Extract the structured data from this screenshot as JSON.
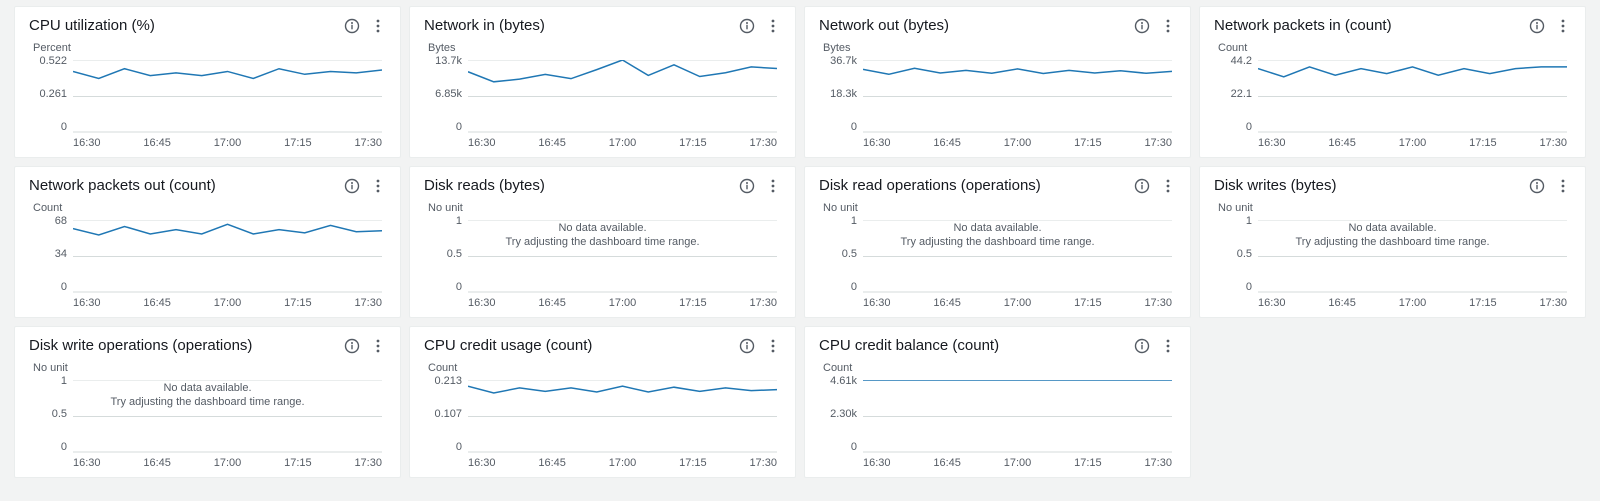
{
  "x_ticks": [
    "16:30",
    "16:45",
    "17:00",
    "17:15",
    "17:30"
  ],
  "nodata": {
    "line1": "No data available.",
    "line2": "Try adjusting the dashboard time range."
  },
  "panels": [
    {
      "id": "cpu-utilization",
      "title": "CPU utilization (%)",
      "unit": "Percent",
      "y_ticks": [
        "0.522",
        "0.261",
        "0"
      ],
      "series_key": "cpu_utilization"
    },
    {
      "id": "network-in",
      "title": "Network in (bytes)",
      "unit": "Bytes",
      "y_ticks": [
        "13.7k",
        "6.85k",
        "0"
      ],
      "series_key": "network_in"
    },
    {
      "id": "network-out",
      "title": "Network out (bytes)",
      "unit": "Bytes",
      "y_ticks": [
        "36.7k",
        "18.3k",
        "0"
      ],
      "series_key": "network_out"
    },
    {
      "id": "network-packets-in",
      "title": "Network packets in (count)",
      "unit": "Count",
      "y_ticks": [
        "44.2",
        "22.1",
        "0"
      ],
      "series_key": "network_packets_in"
    },
    {
      "id": "network-packets-out",
      "title": "Network packets out (count)",
      "unit": "Count",
      "y_ticks": [
        "68",
        "34",
        "0"
      ],
      "series_key": "network_packets_out"
    },
    {
      "id": "disk-reads",
      "title": "Disk reads (bytes)",
      "unit": "No unit",
      "y_ticks": [
        "1",
        "0.5",
        "0"
      ],
      "nodata": true
    },
    {
      "id": "disk-read-operations",
      "title": "Disk read operations (operations)",
      "unit": "No unit",
      "y_ticks": [
        "1",
        "0.5",
        "0"
      ],
      "nodata": true
    },
    {
      "id": "disk-writes",
      "title": "Disk writes (bytes)",
      "unit": "No unit",
      "y_ticks": [
        "1",
        "0.5",
        "0"
      ],
      "nodata": true
    },
    {
      "id": "disk-write-operations",
      "title": "Disk write operations (operations)",
      "unit": "No unit",
      "y_ticks": [
        "1",
        "0.5",
        "0"
      ],
      "nodata": true
    },
    {
      "id": "cpu-credit-usage",
      "title": "CPU credit usage (count)",
      "unit": "Count",
      "y_ticks": [
        "0.213",
        "0.107",
        "0"
      ],
      "series_key": "cpu_credit_usage"
    },
    {
      "id": "cpu-credit-balance",
      "title": "CPU credit balance (count)",
      "unit": "Count",
      "y_ticks": [
        "4.61k",
        "2.30k",
        "0"
      ],
      "series_key": "cpu_credit_balance"
    }
  ],
  "chart_data": {
    "type": "line",
    "x": [
      "16:30",
      "16:35",
      "16:40",
      "16:45",
      "16:50",
      "16:55",
      "17:00",
      "17:05",
      "17:10",
      "17:15",
      "17:20",
      "17:25",
      "17:30"
    ],
    "xlim": [
      "16:30",
      "17:30"
    ],
    "series": {
      "cpu_utilization": {
        "name": "CPU utilization (%)",
        "ylim": [
          0,
          0.522
        ],
        "values": [
          0.44,
          0.39,
          0.46,
          0.41,
          0.43,
          0.41,
          0.44,
          0.39,
          0.46,
          0.42,
          0.44,
          0.43,
          0.45
        ]
      },
      "network_in": {
        "name": "Network in (bytes)",
        "ylim": [
          0,
          13700
        ],
        "values": [
          11500,
          9600,
          10100,
          11000,
          10200,
          11900,
          13700,
          10800,
          12800,
          10600,
          11300,
          12400,
          12100
        ]
      },
      "network_out": {
        "name": "Network out (bytes)",
        "ylim": [
          0,
          36700
        ],
        "values": [
          32000,
          29500,
          32500,
          30200,
          31500,
          30000,
          32200,
          29900,
          31500,
          30200,
          31300,
          30000,
          31000
        ]
      },
      "network_packets_in": {
        "name": "Network packets in (count)",
        "ylim": [
          0,
          44.2
        ],
        "values": [
          39,
          34,
          40,
          35,
          39,
          36,
          40,
          35,
          39,
          36,
          39,
          40,
          40
        ]
      },
      "network_packets_out": {
        "name": "Network packets out (count)",
        "ylim": [
          0,
          68
        ],
        "values": [
          60,
          54,
          62,
          55,
          59,
          55,
          64,
          55,
          59,
          56,
          63,
          57,
          58
        ]
      },
      "cpu_credit_usage": {
        "name": "CPU credit usage (count)",
        "ylim": [
          0,
          0.213
        ],
        "values": [
          0.195,
          0.175,
          0.19,
          0.18,
          0.19,
          0.178,
          0.195,
          0.178,
          0.192,
          0.18,
          0.19,
          0.182,
          0.185
        ]
      },
      "cpu_credit_balance": {
        "name": "CPU credit balance (count)",
        "ylim": [
          0,
          4610
        ],
        "values": [
          4610,
          4610,
          4610,
          4610,
          4610,
          4610,
          4610,
          4610,
          4610,
          4610,
          4610,
          4610,
          4610
        ]
      }
    }
  },
  "colors": {
    "line": "#1f77b4",
    "grid": "#d5dbdb"
  }
}
